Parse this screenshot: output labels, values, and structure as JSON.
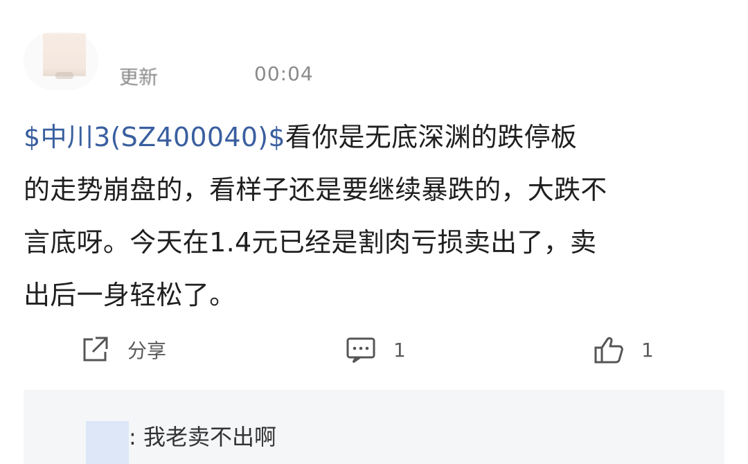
{
  "post": {
    "meta_update": "更新",
    "meta_time": "00:04",
    "stock_tag": "$中川3(SZ400040)$",
    "body_lines": [
      "看你是无底深渊的跌停板",
      "的走势崩盘的，看样子还是要继续暴跌的，大跌不",
      "言底呀。今天在1.4元已经是割肉亏损卖出了，卖",
      "出后一身轻松了。"
    ]
  },
  "actions": {
    "share_label": "分享",
    "comment_count": "1",
    "like_count": "1"
  },
  "reply": {
    "text": ": 我老卖不出啊"
  },
  "colors": {
    "link": "#3a5f9f",
    "text": "#1f1f1f",
    "muted": "#8a8a8a",
    "reply_bg": "#f5f6f8"
  }
}
